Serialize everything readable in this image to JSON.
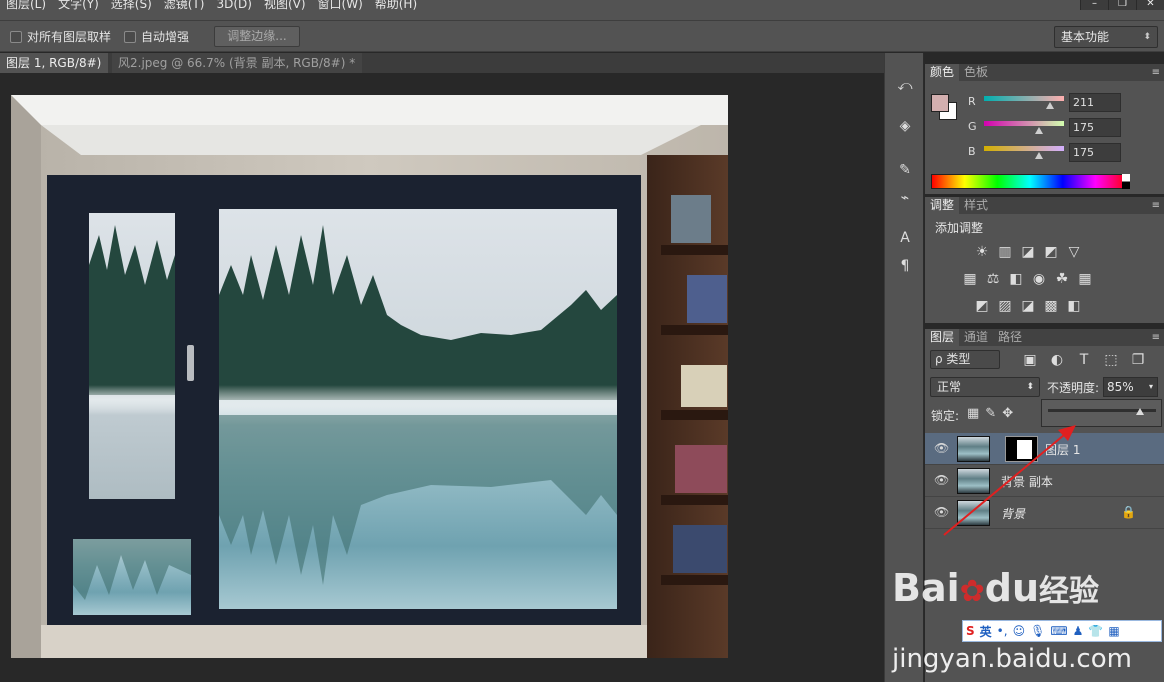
{
  "menu": {
    "items": [
      "图层(L)",
      "文字(Y)",
      "选择(S)",
      "滤镜(T)",
      "3D(D)",
      "视图(V)",
      "窗口(W)",
      "帮助(H)"
    ],
    "window_buttons": [
      "–",
      "❐",
      "✕"
    ]
  },
  "options": {
    "sample_all_layers": "对所有图层取样",
    "auto_enhance": "自动增强",
    "refine_edge": "调整边缘...",
    "workspace": "基本功能",
    "workspace_arrow": "⬍"
  },
  "doc_tabs": [
    {
      "label": "图层 1, RGB/8#) *",
      "close": "×"
    },
    {
      "label": "风2.jpeg @ 66.7% (背景 副本, RGB/8#) *",
      "close": "×"
    }
  ],
  "color_panel": {
    "tabs": [
      "颜色",
      "色板"
    ],
    "fg_color": "#d3afaf",
    "channels": [
      {
        "label": "R",
        "value": "211",
        "fraction": 0.827
      },
      {
        "label": "G",
        "value": "175",
        "fraction": 0.686
      },
      {
        "label": "B",
        "value": "175",
        "fraction": 0.686
      }
    ]
  },
  "adjust_panel": {
    "tabs": [
      "调整",
      "样式"
    ],
    "title": "添加调整",
    "icons_row1": [
      "☀",
      "▥",
      "◪",
      "◩",
      "▽"
    ],
    "icons_row2": [
      "▦",
      "⚖",
      "◧",
      "◉",
      "☘",
      "▦"
    ],
    "icons_row3": [
      "◩",
      "▨",
      "◪",
      "▩",
      "◧"
    ]
  },
  "layers_panel": {
    "tabs": [
      "图层",
      "通道",
      "路径"
    ],
    "filter_label": "ρ 类型",
    "filter_icons": [
      "▣",
      "◐",
      "T",
      "⬚",
      "❐"
    ],
    "blend_mode": "正常",
    "opacity_label": "不透明度:",
    "opacity_value": "85%",
    "opacity_fraction": 0.85,
    "lock_label": "锁定:",
    "layers": [
      {
        "name": "图层 1",
        "has_mask": true,
        "locked": false,
        "italic": false
      },
      {
        "name": "背景 副本",
        "has_mask": false,
        "locked": false,
        "italic": false
      },
      {
        "name": "背景",
        "has_mask": false,
        "locked": true,
        "italic": true
      }
    ]
  },
  "watermark": {
    "brand": "Bai",
    "brand2": "du",
    "cn": "经验",
    "url": "jingyan.baidu.com",
    "ime": "英"
  },
  "colors": {
    "accent_red": "#e02020",
    "selected_layer": "#5a6b80"
  }
}
